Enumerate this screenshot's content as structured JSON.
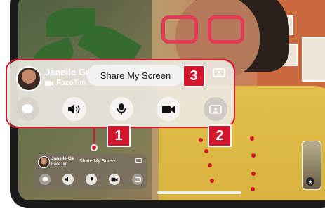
{
  "facetime_panel": {
    "caller_name": "Janelle Ge",
    "call_type": "FaceTim",
    "share_label": "Share My Screen",
    "controls": [
      "chat",
      "speaker",
      "microphone",
      "camera",
      "share-screen"
    ]
  },
  "facetime_panel_small": {
    "caller_name": "Janelle Ge",
    "call_type": "FaceTim",
    "share_label": "Share My Screen"
  },
  "callouts": {
    "one": "1",
    "two": "2",
    "three": "3"
  },
  "colors": {
    "callout_red": "#d3152b",
    "panel_bg": "#ebe8e1"
  },
  "icons": {
    "chat": "chat-bubble-icon",
    "speaker": "speaker-icon",
    "microphone": "microphone-icon",
    "camera": "video-camera-icon",
    "share": "screen-share-icon",
    "favorite": "star-icon"
  }
}
